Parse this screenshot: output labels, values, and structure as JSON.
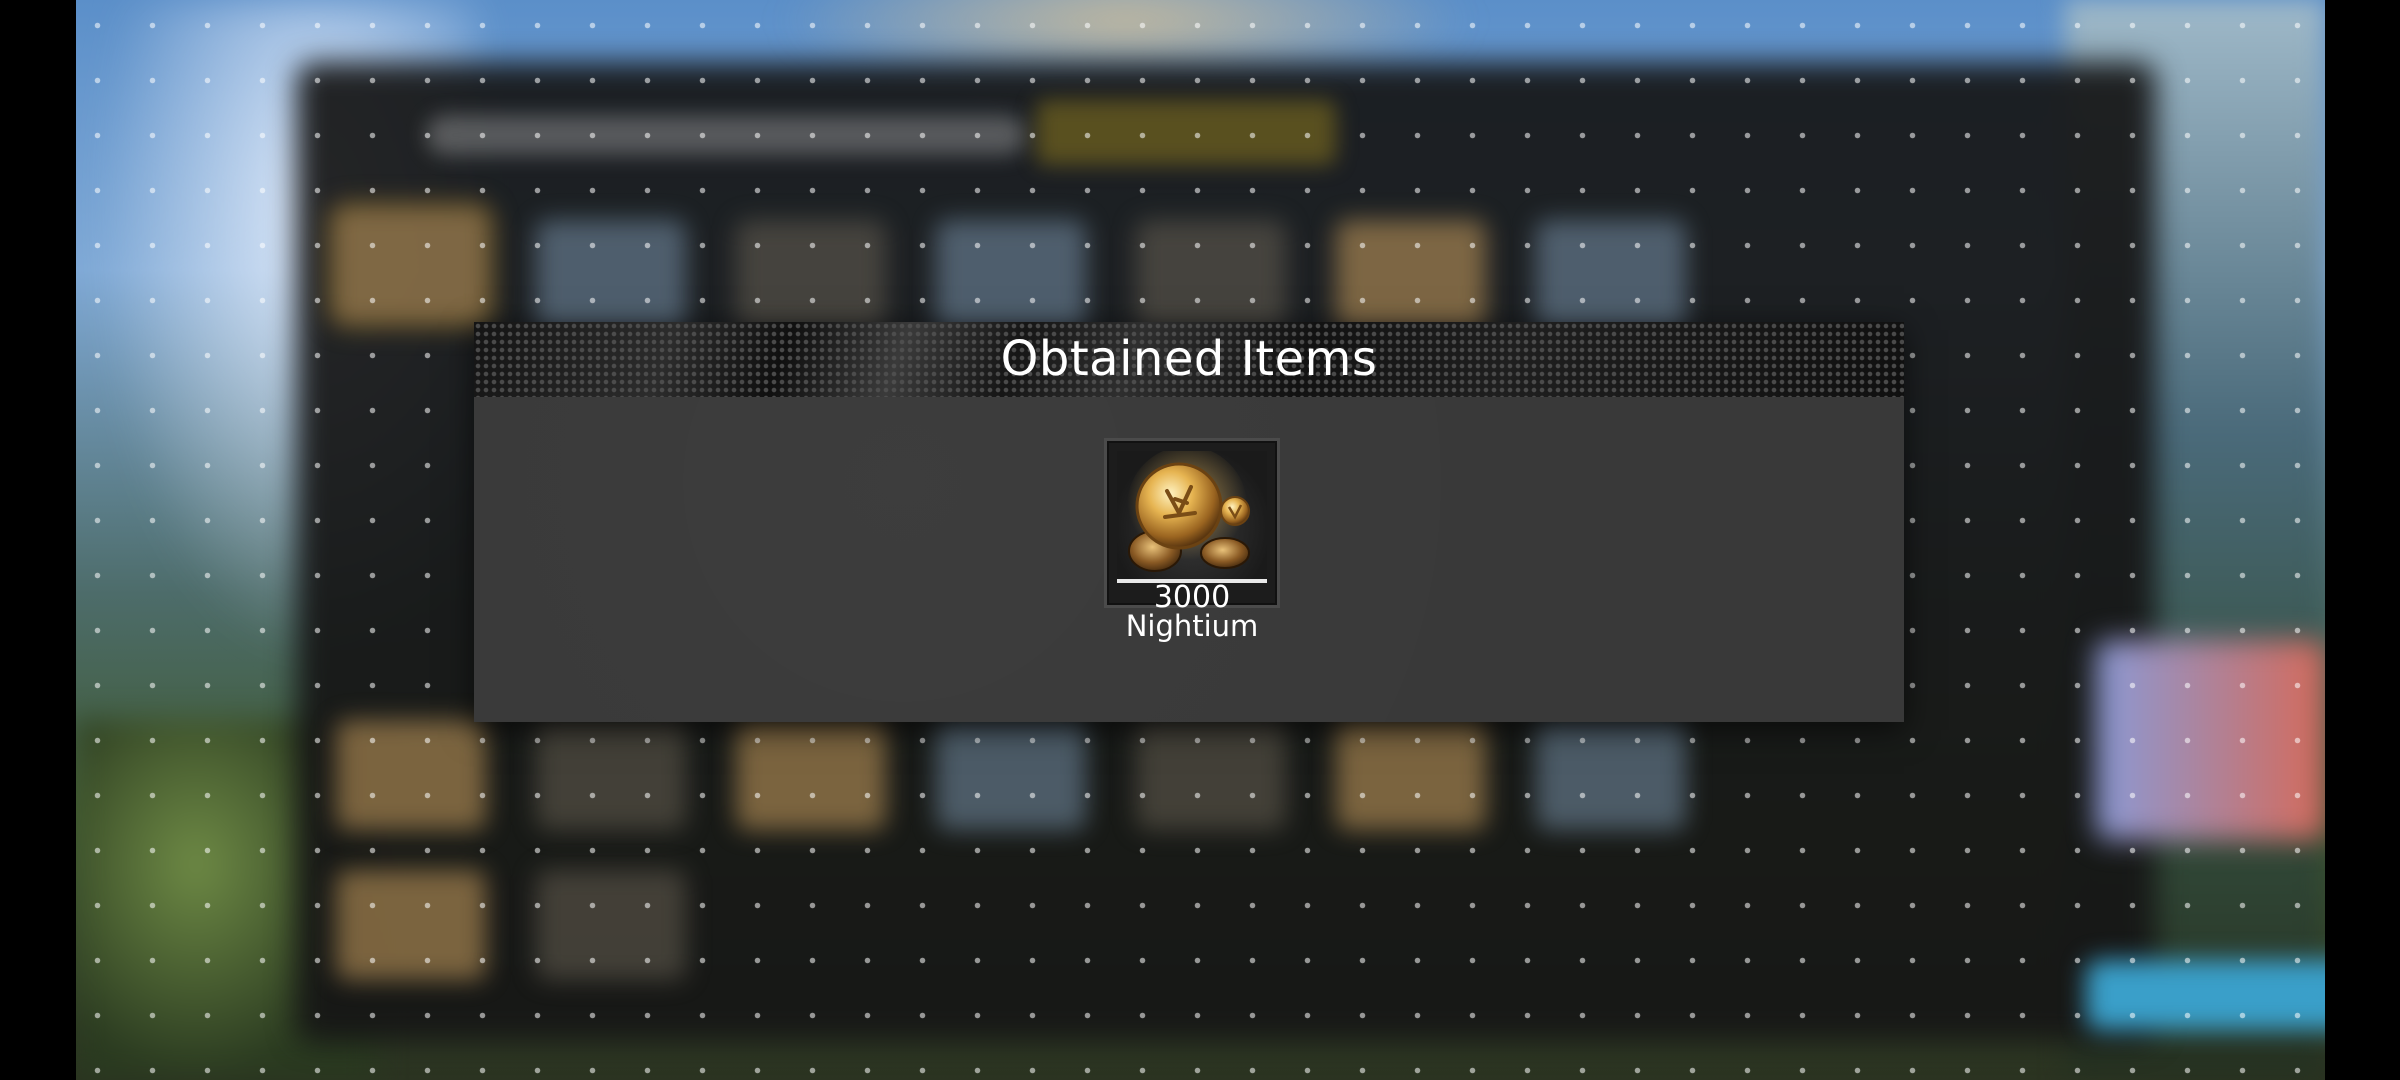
{
  "dialog": {
    "title": "Obtained Items",
    "items": [
      {
        "name": "Nightium",
        "quantity": "3000",
        "icon": "nightium-coins-icon"
      }
    ]
  },
  "colors": {
    "modal_bg": "#393939",
    "header_bg": "#1a1a1a",
    "text": "#ffffff",
    "coin_gold": "#d9a441"
  }
}
